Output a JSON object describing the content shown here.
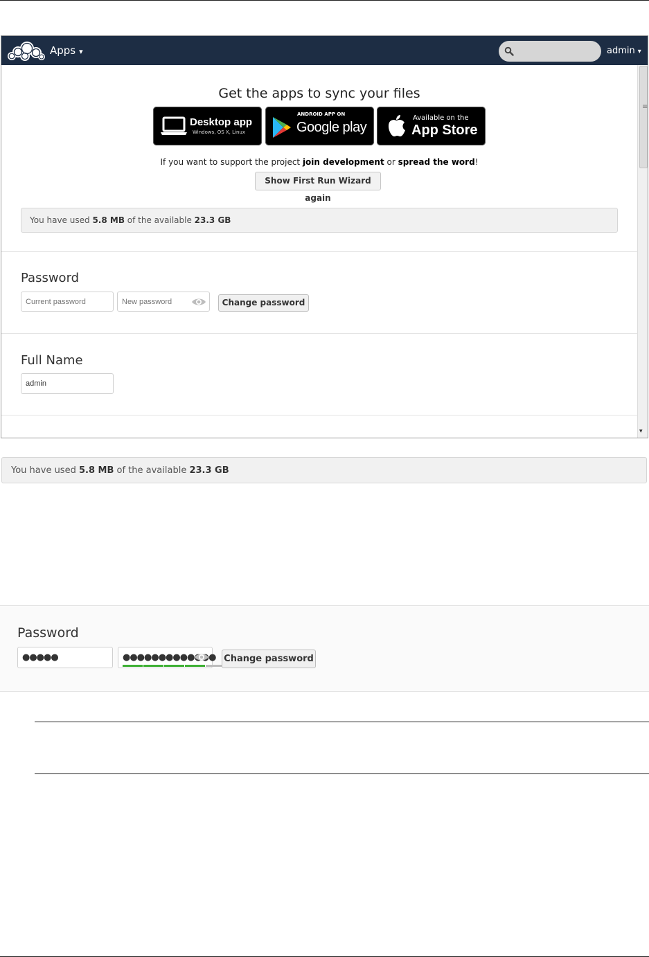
{
  "topbar": {
    "apps_label": "Apps",
    "apps_caret": "▾",
    "search_placeholder": "",
    "user_label": "admin",
    "user_caret": "▾"
  },
  "sync": {
    "title": "Get the apps to sync your files",
    "desktop": {
      "title": "Desktop app",
      "subtitle": "Windows, OS X, Linux"
    },
    "play": {
      "small": "ANDROID APP ON",
      "big": "Google play"
    },
    "store": {
      "small": "Available on the",
      "big": "App Store"
    }
  },
  "support": {
    "prefix": "If you want to support the project ",
    "link1": "join development",
    "middle": " or ",
    "link2": "spread the word",
    "suffix": "!",
    "wizard_button": "Show First Run Wizard again"
  },
  "quota": {
    "prefix": "You have used ",
    "used": "5.8 MB",
    "middle": " of the available ",
    "total": "23.3 GB"
  },
  "password": {
    "heading": "Password",
    "current_placeholder": "Current password",
    "new_placeholder": "New password",
    "change_button": "Change password"
  },
  "fullname": {
    "heading": "Full Name",
    "value": "admin"
  },
  "password_filled": {
    "heading": "Password",
    "current_value": "●●●●●",
    "new_value": "●●●●●●●●●●●●●",
    "strength_segments": [
      {
        "color": "#3fb035",
        "filled": true
      },
      {
        "color": "#3fb035",
        "filled": true
      },
      {
        "color": "#3fb035",
        "filled": true
      },
      {
        "color": "#3fb035",
        "filled": true
      },
      {
        "color": "#bdbdbd",
        "filled": false
      }
    ],
    "change_button": "Change password"
  },
  "colors": {
    "topbar": "#1d2d44",
    "strength_strong": "#3fb035"
  }
}
